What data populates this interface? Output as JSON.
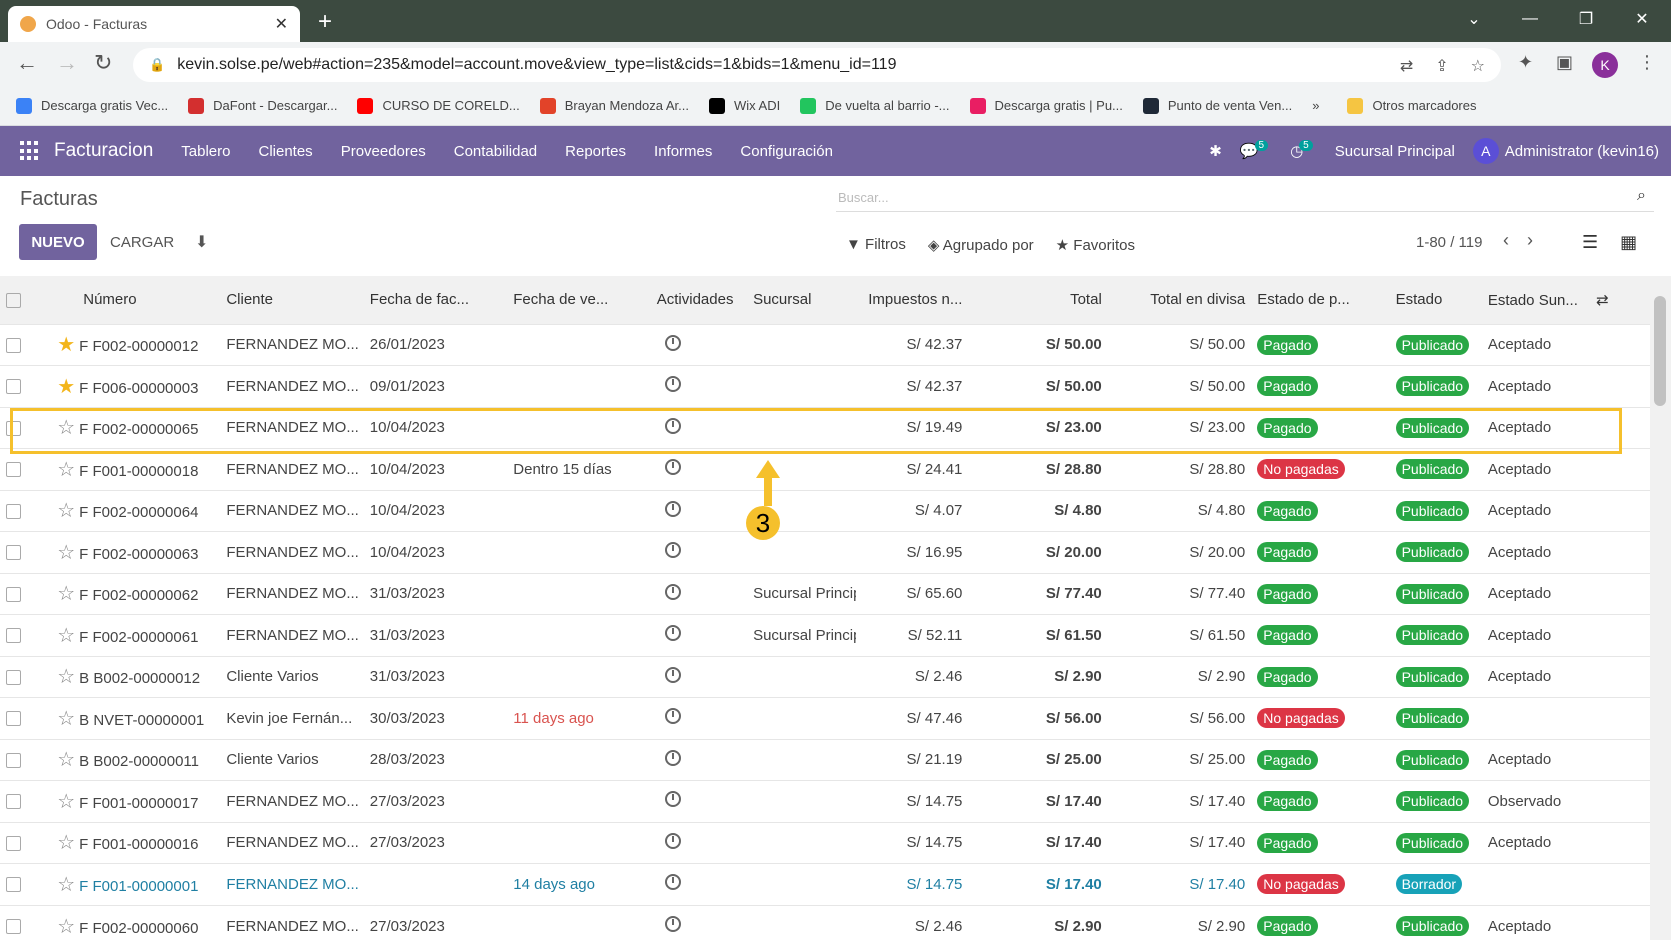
{
  "browser": {
    "tab_title": "Odoo - Facturas",
    "url": "kevin.solse.pe/web#action=235&model=account.move&view_type=list&cids=1&bids=1&menu_id=119",
    "bookmarks": [
      {
        "label": "Descarga gratis Vec...",
        "color": "#3b82f6"
      },
      {
        "label": "DaFont - Descargar...",
        "color": "#d32f2f"
      },
      {
        "label": "CURSO DE CORELD...",
        "color": "#ff0000"
      },
      {
        "label": "Brayan Mendoza Ar...",
        "color": "#e24329"
      },
      {
        "label": "Wix ADI",
        "color": "#000000"
      },
      {
        "label": "De vuelta al barrio -...",
        "color": "#22c55e"
      },
      {
        "label": "Descarga gratis | Pu...",
        "color": "#e91e63"
      },
      {
        "label": "Punto de venta Ven...",
        "color": "#1f2937"
      }
    ],
    "bookmarks_more": "»",
    "other_bookmarks": "Otros marcadores",
    "profile_initial": "K"
  },
  "navbar": {
    "brand": "Facturacion",
    "menu": [
      "Tablero",
      "Clientes",
      "Proveedores",
      "Contabilidad",
      "Reportes",
      "Informes",
      "Configuración"
    ],
    "messages_count": "5",
    "activities_count": "5",
    "branch": "Sucursal Principal",
    "user_initial": "A",
    "user": "Administrator (kevin16)"
  },
  "control": {
    "title": "Facturas",
    "search_placeholder": "Buscar...",
    "new_label": "NUEVO",
    "upload_label": "CARGAR",
    "filters": "Filtros",
    "group_by": "Agrupado por",
    "favorites": "Favoritos",
    "pager": "1-80 / 119"
  },
  "columns": [
    "Número",
    "Cliente",
    "Fecha de fac...",
    "Fecha de ve...",
    "Actividades",
    "Sucursal",
    "Impuestos n...",
    "Total",
    "Total en divisa",
    "Estado de p...",
    "Estado",
    "Estado Sun..."
  ],
  "rows": [
    {
      "fav": true,
      "number": "F F002-00000012",
      "client": "FERNANDEZ MO...",
      "date": "26/01/2023",
      "due": "",
      "due_overdue": false,
      "branch": "",
      "tax": "S/ 42.37",
      "total": "S/ 50.00",
      "total_cur": "S/ 50.00",
      "pay": "Pagado",
      "pay_color": "green",
      "state": "Publicado",
      "state_color": "green",
      "sunat": "Aceptado"
    },
    {
      "fav": true,
      "number": "F F006-00000003",
      "client": "FERNANDEZ MO...",
      "date": "09/01/2023",
      "due": "",
      "due_overdue": false,
      "branch": "",
      "tax": "S/ 42.37",
      "total": "S/ 50.00",
      "total_cur": "S/ 50.00",
      "pay": "Pagado",
      "pay_color": "green",
      "state": "Publicado",
      "state_color": "green",
      "sunat": "Aceptado"
    },
    {
      "fav": false,
      "number": "F F002-00000065",
      "client": "FERNANDEZ MO...",
      "date": "10/04/2023",
      "due": "",
      "due_overdue": false,
      "branch": "",
      "tax": "S/ 19.49",
      "total": "S/ 23.00",
      "total_cur": "S/ 23.00",
      "pay": "Pagado",
      "pay_color": "green",
      "state": "Publicado",
      "state_color": "green",
      "sunat": "Aceptado"
    },
    {
      "fav": false,
      "number": "F F001-00000018",
      "client": "FERNANDEZ MO...",
      "date": "10/04/2023",
      "due": "Dentro 15 días",
      "due_overdue": false,
      "branch": "",
      "tax": "S/ 24.41",
      "total": "S/ 28.80",
      "total_cur": "S/ 28.80",
      "pay": "No pagadas",
      "pay_color": "red",
      "state": "Publicado",
      "state_color": "green",
      "sunat": "Aceptado"
    },
    {
      "fav": false,
      "number": "F F002-00000064",
      "client": "FERNANDEZ MO...",
      "date": "10/04/2023",
      "due": "",
      "due_overdue": false,
      "branch": "",
      "tax": "S/ 4.07",
      "total": "S/ 4.80",
      "total_cur": "S/ 4.80",
      "pay": "Pagado",
      "pay_color": "green",
      "state": "Publicado",
      "state_color": "green",
      "sunat": "Aceptado"
    },
    {
      "fav": false,
      "number": "F F002-00000063",
      "client": "FERNANDEZ MO...",
      "date": "10/04/2023",
      "due": "",
      "due_overdue": false,
      "branch": "",
      "tax": "S/ 16.95",
      "total": "S/ 20.00",
      "total_cur": "S/ 20.00",
      "pay": "Pagado",
      "pay_color": "green",
      "state": "Publicado",
      "state_color": "green",
      "sunat": "Aceptado"
    },
    {
      "fav": false,
      "number": "F F002-00000062",
      "client": "FERNANDEZ MO...",
      "date": "31/03/2023",
      "due": "",
      "due_overdue": false,
      "branch": "Sucursal Principal",
      "tax": "S/ 65.60",
      "total": "S/ 77.40",
      "total_cur": "S/ 77.40",
      "pay": "Pagado",
      "pay_color": "green",
      "state": "Publicado",
      "state_color": "green",
      "sunat": "Aceptado"
    },
    {
      "fav": false,
      "number": "F F002-00000061",
      "client": "FERNANDEZ MO...",
      "date": "31/03/2023",
      "due": "",
      "due_overdue": false,
      "branch": "Sucursal Principal",
      "tax": "S/ 52.11",
      "total": "S/ 61.50",
      "total_cur": "S/ 61.50",
      "pay": "Pagado",
      "pay_color": "green",
      "state": "Publicado",
      "state_color": "green",
      "sunat": "Aceptado"
    },
    {
      "fav": false,
      "number": "B B002-00000012",
      "client": "Cliente Varios",
      "date": "31/03/2023",
      "due": "",
      "due_overdue": false,
      "branch": "",
      "tax": "S/ 2.46",
      "total": "S/ 2.90",
      "total_cur": "S/ 2.90",
      "pay": "Pagado",
      "pay_color": "green",
      "state": "Publicado",
      "state_color": "green",
      "sunat": "Aceptado"
    },
    {
      "fav": false,
      "number": "B NVET-00000001",
      "client": "Kevin joe Fernán...",
      "date": "30/03/2023",
      "due": "11 days ago",
      "due_overdue": true,
      "branch": "",
      "tax": "S/ 47.46",
      "total": "S/ 56.00",
      "total_cur": "S/ 56.00",
      "pay": "No pagadas",
      "pay_color": "red",
      "state": "Publicado",
      "state_color": "green",
      "sunat": ""
    },
    {
      "fav": false,
      "number": "B B002-00000011",
      "client": "Cliente Varios",
      "date": "28/03/2023",
      "due": "",
      "due_overdue": false,
      "branch": "",
      "tax": "S/ 21.19",
      "total": "S/ 25.00",
      "total_cur": "S/ 25.00",
      "pay": "Pagado",
      "pay_color": "green",
      "state": "Publicado",
      "state_color": "green",
      "sunat": "Aceptado"
    },
    {
      "fav": false,
      "number": "F F001-00000017",
      "client": "FERNANDEZ MO...",
      "date": "27/03/2023",
      "due": "",
      "due_overdue": false,
      "branch": "",
      "tax": "S/ 14.75",
      "total": "S/ 17.40",
      "total_cur": "S/ 17.40",
      "pay": "Pagado",
      "pay_color": "green",
      "state": "Publicado",
      "state_color": "green",
      "sunat": "Observado"
    },
    {
      "fav": false,
      "number": "F F001-00000016",
      "client": "FERNANDEZ MO...",
      "date": "27/03/2023",
      "due": "",
      "due_overdue": false,
      "branch": "",
      "tax": "S/ 14.75",
      "total": "S/ 17.40",
      "total_cur": "S/ 17.40",
      "pay": "Pagado",
      "pay_color": "green",
      "state": "Publicado",
      "state_color": "green",
      "sunat": "Aceptado"
    },
    {
      "fav": false,
      "number": "F F001-00000001",
      "client": "FERNANDEZ MO...",
      "date": "",
      "due": "14 days ago",
      "due_overdue": true,
      "branch": "",
      "tax": "S/ 14.75",
      "total": "S/ 17.40",
      "total_cur": "S/ 17.40",
      "pay": "No pagadas",
      "pay_color": "red",
      "state": "Borrador",
      "state_color": "blue",
      "sunat": "",
      "draft": true
    },
    {
      "fav": false,
      "number": "F F002-00000060",
      "client": "FERNANDEZ MO...",
      "date": "27/03/2023",
      "due": "",
      "due_overdue": false,
      "branch": "",
      "tax": "S/ 2.46",
      "total": "S/ 2.90",
      "total_cur": "S/ 2.90",
      "pay": "Pagado",
      "pay_color": "green",
      "state": "Publicado",
      "state_color": "green",
      "sunat": "Aceptado"
    }
  ],
  "annotation": {
    "step": "3",
    "color": "#f5c02c"
  }
}
